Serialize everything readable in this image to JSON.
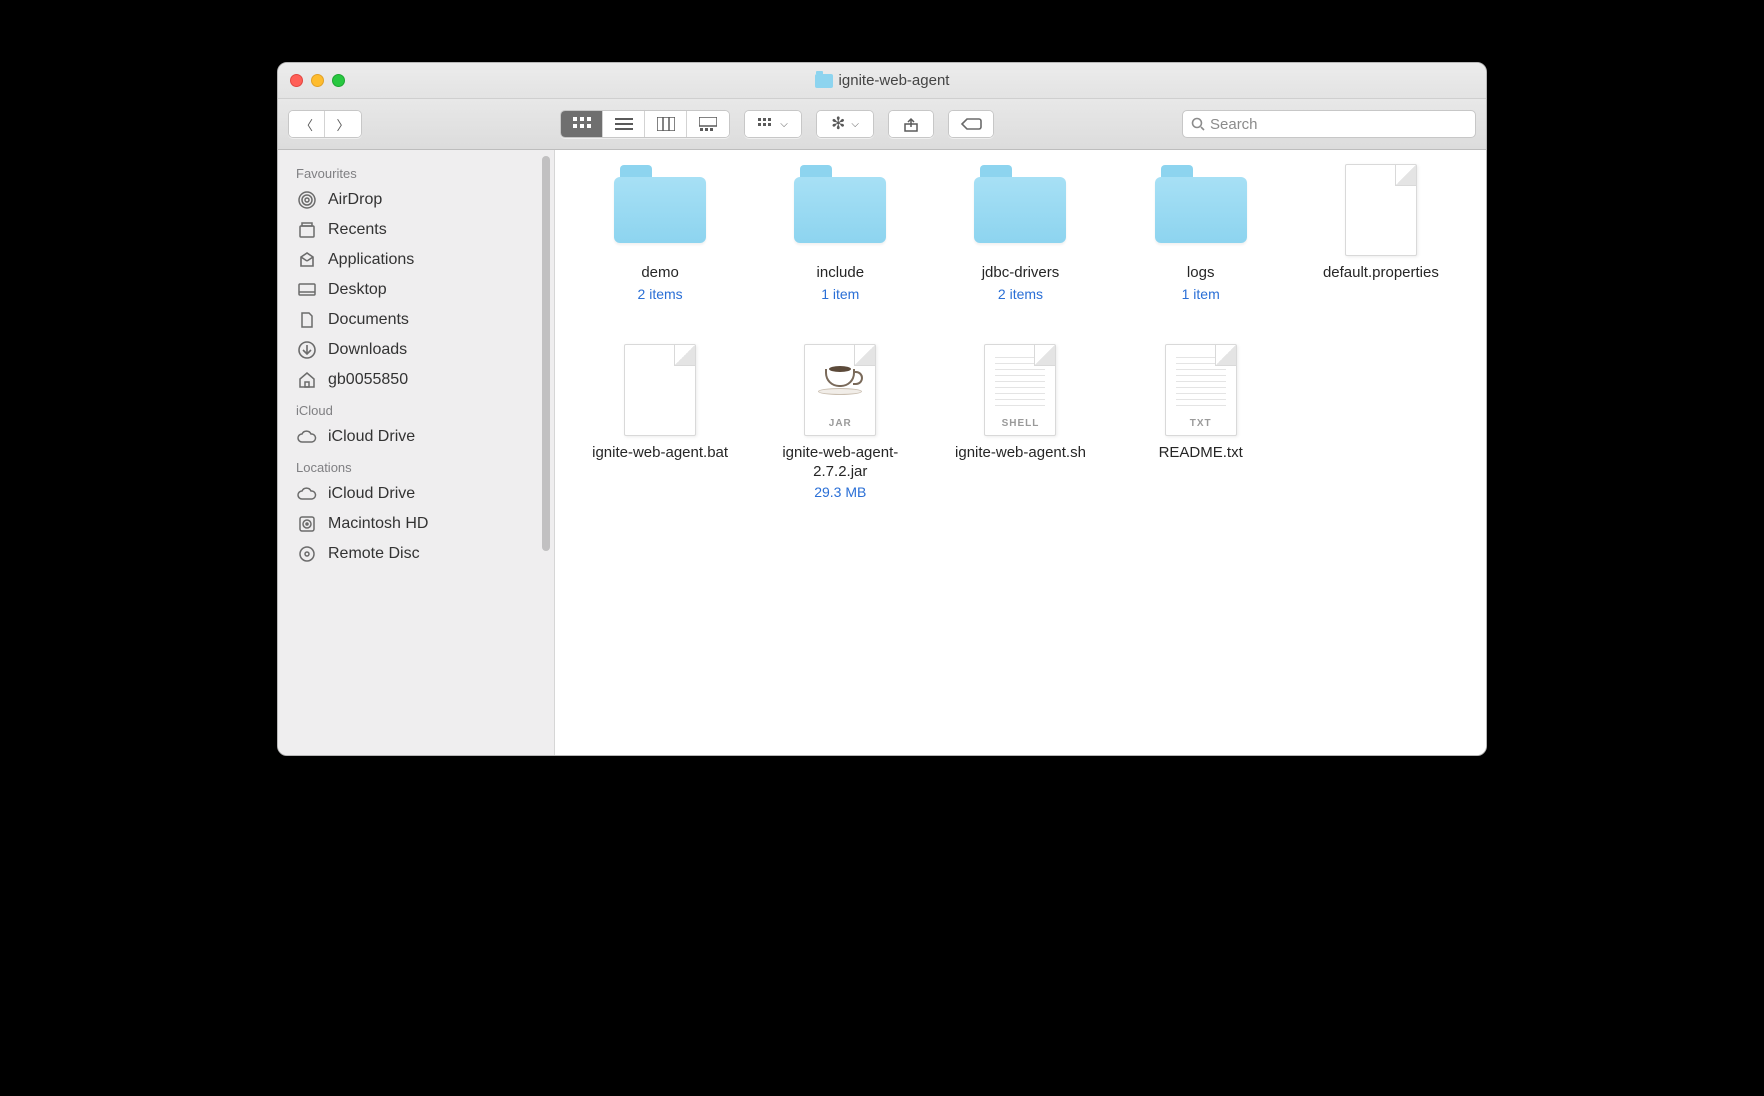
{
  "window": {
    "title": "ignite-web-agent"
  },
  "search": {
    "placeholder": "Search"
  },
  "sidebar": {
    "sections": [
      {
        "title": "Favourites",
        "items": [
          {
            "label": "AirDrop",
            "icon": "airdrop"
          },
          {
            "label": "Recents",
            "icon": "recents"
          },
          {
            "label": "Applications",
            "icon": "apps"
          },
          {
            "label": "Desktop",
            "icon": "desktop"
          },
          {
            "label": "Documents",
            "icon": "documents"
          },
          {
            "label": "Downloads",
            "icon": "downloads"
          },
          {
            "label": "gb0055850",
            "icon": "home"
          }
        ]
      },
      {
        "title": "iCloud",
        "items": [
          {
            "label": "iCloud Drive",
            "icon": "cloud"
          }
        ]
      },
      {
        "title": "Locations",
        "items": [
          {
            "label": "iCloud Drive",
            "icon": "cloud"
          },
          {
            "label": "Macintosh HD",
            "icon": "hdd"
          },
          {
            "label": "Remote Disc",
            "icon": "disc"
          }
        ]
      }
    ]
  },
  "files": [
    {
      "name": "demo",
      "sub": "2 items",
      "kind": "folder"
    },
    {
      "name": "include",
      "sub": "1 item",
      "kind": "folder"
    },
    {
      "name": "jdbc-drivers",
      "sub": "2 items",
      "kind": "folder"
    },
    {
      "name": "logs",
      "sub": "1 item",
      "kind": "folder"
    },
    {
      "name": "default.properties",
      "sub": "",
      "kind": "blank"
    },
    {
      "name": "ignite-web-agent.bat",
      "sub": "",
      "kind": "blank"
    },
    {
      "name": "ignite-web-agent-2.7.2.jar",
      "sub": "29.3 MB",
      "kind": "jar"
    },
    {
      "name": "ignite-web-agent.sh",
      "sub": "",
      "kind": "shell"
    },
    {
      "name": "README.txt",
      "sub": "",
      "kind": "txt"
    }
  ]
}
